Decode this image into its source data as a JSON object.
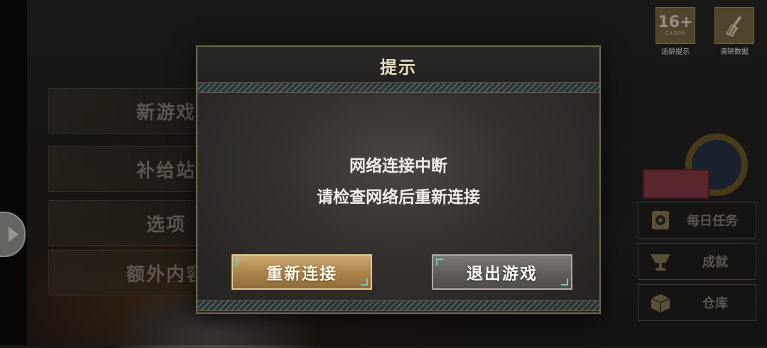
{
  "background_menu": {
    "items": [
      {
        "label": "新游戏"
      },
      {
        "label": "补给站"
      },
      {
        "label": "选项"
      },
      {
        "label": "额外内容"
      }
    ]
  },
  "top_right": {
    "age_rating": {
      "number": "16+",
      "sub": "CADPA",
      "caption": "适龄提示"
    },
    "clear_data": {
      "caption": "清除数据"
    }
  },
  "side_menu": {
    "daily_tasks": "每日任务",
    "achievements": "成就",
    "warehouse": "仓库"
  },
  "dialog": {
    "title": "提示",
    "message_line1": "网络连接中断",
    "message_line2": "请检查网络后重新连接",
    "reconnect_label": "重新连接",
    "exit_label": "退出游戏"
  },
  "colors": {
    "reconnect_gold": "#cba76e",
    "exit_gray": "#6a6762",
    "dialog_border": "#6e664f",
    "corner_teal": "#7cc8b8"
  }
}
